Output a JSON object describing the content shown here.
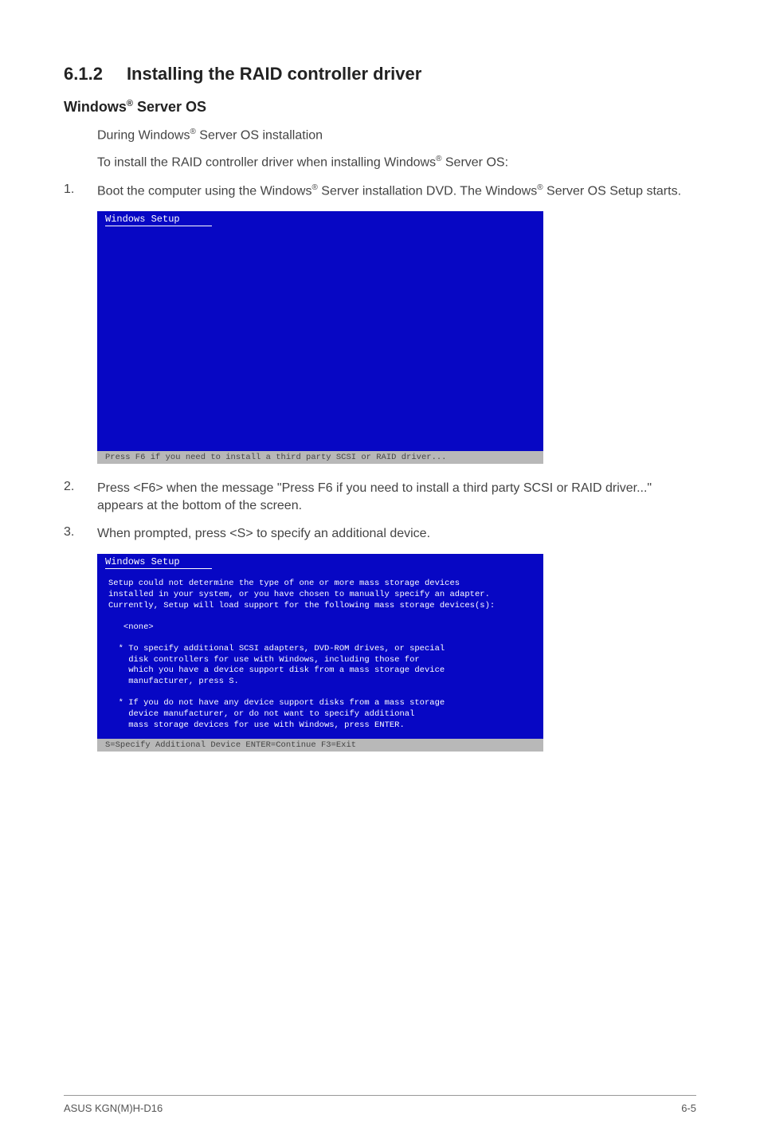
{
  "section": {
    "number": "6.1.2",
    "title": "Installing the RAID controller driver"
  },
  "subheading": {
    "prefix": "Windows",
    "reg": "®",
    "suffix": " Server OS"
  },
  "intro": {
    "line1_a": "During Windows",
    "line1_reg": "®",
    "line1_b": " Server OS installation",
    "line2_a": "To install the RAID controller driver when installing Windows",
    "line2_reg": "®",
    "line2_b": " Server OS:"
  },
  "steps": [
    {
      "num": "1.",
      "a": "Boot the computer using the Windows",
      "reg1": "®",
      "b": " Server installation DVD. The Windows",
      "reg2": "®",
      "c": " Server OS Setup starts."
    },
    {
      "num": "2.",
      "a": "Press <F6> when the message \"Press F6 if you need to install a third party SCSI or RAID driver...\" appears at the bottom of the screen.",
      "reg1": "",
      "b": "",
      "reg2": "",
      "c": ""
    },
    {
      "num": "3.",
      "a": "When prompted, press <S> to specify an additional device.",
      "reg1": "",
      "b": "",
      "reg2": "",
      "c": ""
    }
  ],
  "screenshot1": {
    "title": "Windows Setup",
    "status": "Press F6 if you need to install a third party SCSI or RAID driver..."
  },
  "screenshot2": {
    "title": "Windows Setup",
    "body": "Setup could not determine the type of one or more mass storage devices\ninstalled in your system, or you have chosen to manually specify an adapter.\nCurrently, Setup will load support for the following mass storage devices(s):\n\n   <none>\n\n  * To specify additional SCSI adapters, DVD-ROM drives, or special\n    disk controllers for use with Windows, including those for\n    which you have a device support disk from a mass storage device\n    manufacturer, press S.\n\n  * If you do not have any device support disks from a mass storage\n    device manufacturer, or do not want to specify additional\n    mass storage devices for use with Windows, press ENTER.",
    "status": "S=Specify Additional Device    ENTER=Continue    F3=Exit"
  },
  "footer": {
    "left": "ASUS KGN(M)H-D16",
    "right": "6-5"
  }
}
